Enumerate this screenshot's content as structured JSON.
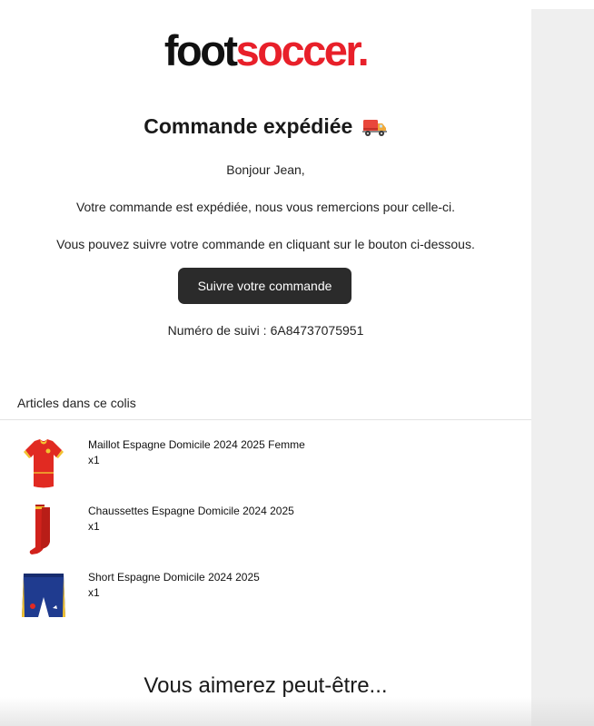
{
  "brand": {
    "logo_foot": "foot",
    "logo_soccer": "soccer",
    "logo_dot": ".",
    "accent_color": "#e8202a"
  },
  "header": {
    "title": "Commande expédiée",
    "title_icon": "delivery-truck-icon"
  },
  "body": {
    "greeting": "Bonjour Jean,",
    "line1": "Votre commande est expédiée, nous vous remercions pour celle-ci.",
    "line2": "Vous pouvez suivre votre commande en cliquant sur le bouton ci-dessous.",
    "button_label": "Suivre votre commande",
    "tracking_label": "Numéro de suivi :",
    "tracking_number": "6A84737075951"
  },
  "items_section": {
    "title": "Articles dans ce colis",
    "items": [
      {
        "name": "Maillot Espagne Domicile 2024 2025 Femme",
        "qty": "x1",
        "icon": "jersey-icon"
      },
      {
        "name": "Chaussettes Espagne Domicile 2024 2025",
        "qty": "x1",
        "icon": "socks-icon"
      },
      {
        "name": "Short Espagne Domicile 2024 2025",
        "qty": "x1",
        "icon": "shorts-icon"
      }
    ]
  },
  "recommendations": {
    "title": "Vous aimerez peut-être..."
  }
}
